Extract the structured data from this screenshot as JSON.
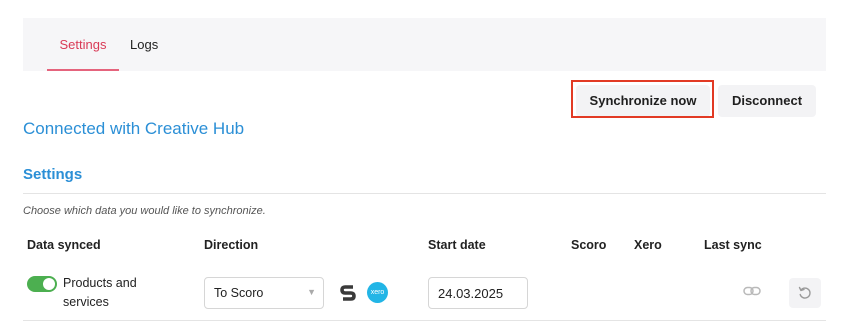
{
  "tabs": [
    {
      "label": "Settings",
      "active": true
    },
    {
      "label": "Logs",
      "active": false
    }
  ],
  "actions": {
    "sync_label": "Synchronize now",
    "disconnect_label": "Disconnect"
  },
  "connection_status": "Connected with Creative Hub",
  "settings_section": {
    "title": "Settings",
    "hint": "Choose which data you would like to synchronize."
  },
  "table": {
    "headers": [
      "Data synced",
      "Direction",
      "Start date",
      "Scoro",
      "Xero",
      "Last sync"
    ],
    "rows": [
      {
        "enabled": true,
        "label": "Products and services",
        "direction": "To Scoro",
        "start_date": "24.03.2025",
        "logos": [
          "scoro-logo",
          "xero-logo"
        ],
        "xero_logo_text": "xero",
        "last_sync_icon": "link-icon",
        "action_icon": "undo-icon"
      }
    ]
  },
  "colors": {
    "accent_blue": "#2b8fd6",
    "active_tab": "#d93b57",
    "toggle_on": "#4caf50",
    "highlight_box": "#e23a24",
    "xero_brand": "#22b5e6"
  }
}
